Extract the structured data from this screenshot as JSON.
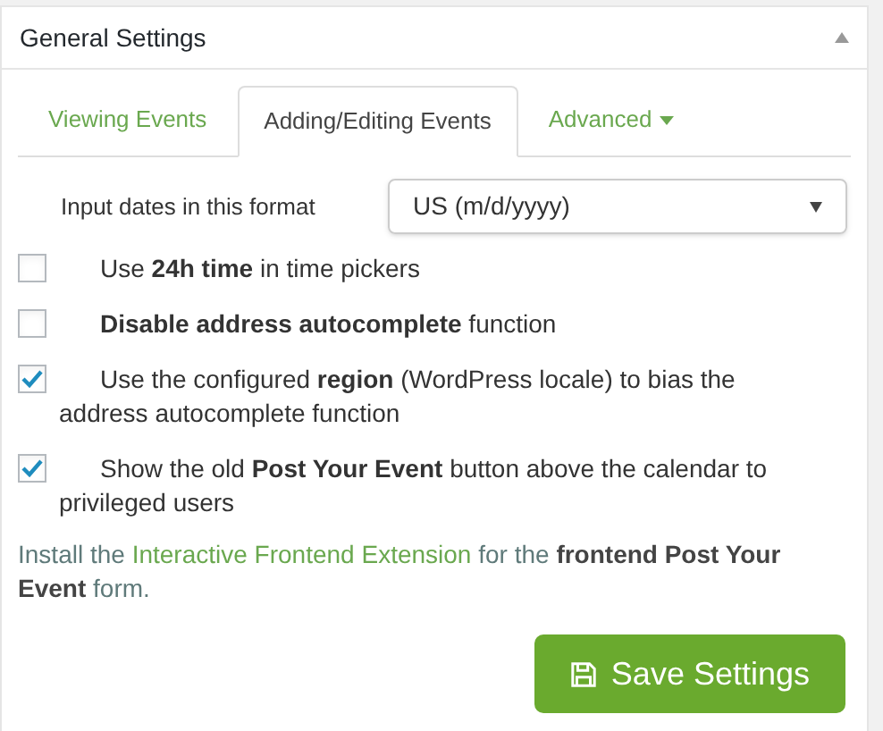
{
  "panel": {
    "title": "General Settings",
    "collapsed": false
  },
  "tabs": [
    {
      "label": "Viewing Events",
      "selected": false,
      "has_menu": false
    },
    {
      "label": "Adding/Editing Events",
      "selected": true,
      "has_menu": false
    },
    {
      "label": "Advanced",
      "selected": false,
      "has_menu": true
    }
  ],
  "date_format": {
    "label": "Input dates in this format",
    "value": "US (m/d/yyyy)"
  },
  "options": [
    {
      "label": "Use **24h time** in time pickers",
      "checked": false
    },
    {
      "label": "**Disable address autocomplete** function",
      "checked": false
    },
    {
      "label": "Use the configured **region** (WordPress locale) to bias the address autocomplete function",
      "checked": true
    },
    {
      "label": "Show the old **Post Your Event** button above the calendar to privileged users",
      "checked": true
    }
  ],
  "note": {
    "prefix": "Install the ",
    "link": "Interactive Frontend Extension",
    "suffix": " for the **frontend Post Your Event** form."
  },
  "save_button": {
    "label": "Save Settings"
  }
}
